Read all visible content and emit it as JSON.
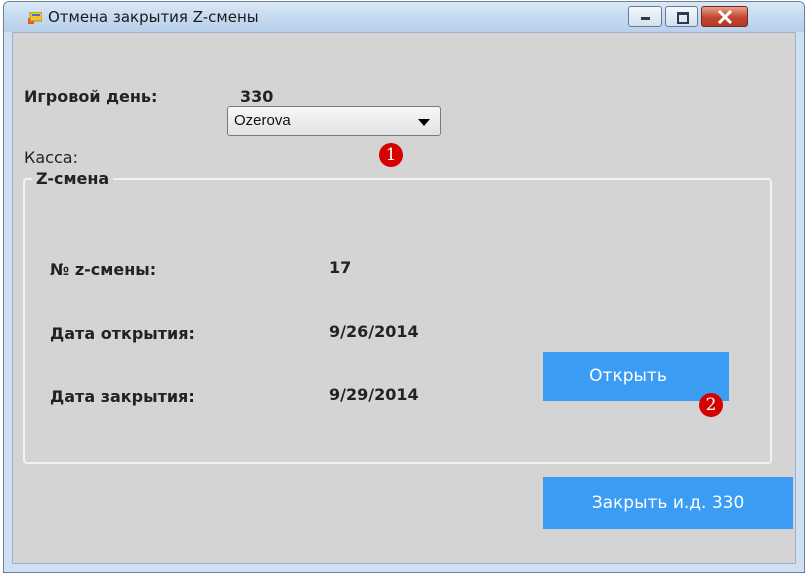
{
  "window": {
    "title": "Отмена закрытия Z-смены",
    "controls": [
      "minimize-icon",
      "maximize-icon",
      "close-icon"
    ]
  },
  "game_day": {
    "label": "Игровой день:",
    "value": "330"
  },
  "cash_register": {
    "label": "Касса:",
    "selected": "Ozerova",
    "marker": "1"
  },
  "z_shift": {
    "title": "Z-смена",
    "number": {
      "label": "№ z-смены:",
      "value": "17"
    },
    "open_date": {
      "label": "Дата открытия:",
      "value": "9/26/2014"
    },
    "close_date": {
      "label": "Дата закрытия:",
      "value": "9/29/2014"
    },
    "open_button": {
      "label": "Открыть",
      "marker": "2"
    }
  },
  "close_day_button": {
    "label": "Закрыть и.д. 330"
  },
  "colors": {
    "button": "#3a9cf3",
    "marker": "#d50000",
    "client_bg": "#d4d4d4"
  }
}
